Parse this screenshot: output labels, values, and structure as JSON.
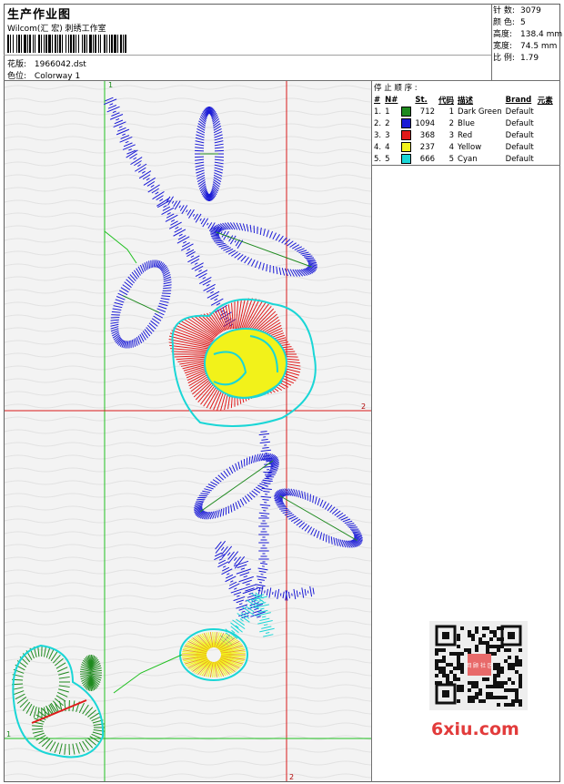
{
  "header": {
    "title": "生产作业图",
    "company": "Wilcom(汇 宏) 刺绣工作室",
    "design_label": "花版:",
    "design_value": "1966042.dst",
    "colorway_label": "色位:",
    "colorway_value": "Colorway 1"
  },
  "stats": [
    {
      "label": "针 数:",
      "value": "3079"
    },
    {
      "label": "颜 色:",
      "value": "5"
    },
    {
      "label": "高度:",
      "value": "138.4 mm"
    },
    {
      "label": "宽度:",
      "value": "74.5 mm"
    },
    {
      "label": "比 例:",
      "value": "1.79"
    }
  ],
  "legend": {
    "title": "停 止 顺 序 :",
    "headers": [
      "#",
      "N#",
      "",
      "St.",
      "代码",
      "描述",
      "Brand",
      "元素"
    ],
    "rows": [
      {
        "num": "1.",
        "n": "1",
        "color": "#1f8a1f",
        "st": "712",
        "code": "1",
        "desc": "Dark Green",
        "brand": "Default"
      },
      {
        "num": "2.",
        "n": "2",
        "color": "#1a1ad6",
        "st": "1094",
        "code": "2",
        "desc": "Blue",
        "brand": "Default"
      },
      {
        "num": "3.",
        "n": "3",
        "color": "#e01a1a",
        "st": "368",
        "code": "3",
        "desc": "Red",
        "brand": "Default"
      },
      {
        "num": "4.",
        "n": "4",
        "color": "#f2f21a",
        "st": "237",
        "code": "4",
        "desc": "Yellow",
        "brand": "Default"
      },
      {
        "num": "5.",
        "n": "5",
        "color": "#1ad6d6",
        "st": "666",
        "code": "5",
        "desc": "Cyan",
        "brand": "Default"
      }
    ]
  },
  "guides": {
    "v1": "1",
    "v2": "2",
    "h1": "1",
    "h2": "2"
  },
  "watermark": "6xiu.com",
  "qr_center": "回 顾 社 区"
}
